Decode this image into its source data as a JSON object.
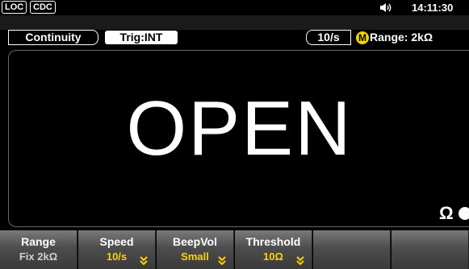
{
  "status": {
    "loc": "LOC",
    "cdc": "CDC",
    "time": "14:11:30"
  },
  "info": {
    "mode": "Continuity",
    "trigger": "Trig:INT",
    "rate": "10/s",
    "m_icon": "M",
    "range": "Range:  2kΩ"
  },
  "display": {
    "reading": "OPEN",
    "unit": "Ω"
  },
  "softkeys": [
    {
      "label": "Range",
      "value": "Fix 2kΩ"
    },
    {
      "label": "Speed",
      "value": "10/s"
    },
    {
      "label": "BeepVol",
      "value": "Small"
    },
    {
      "label": "Threshold",
      "value": "10Ω"
    },
    {
      "label": "",
      "value": ""
    },
    {
      "label": "",
      "value": ""
    }
  ],
  "colors": {
    "accent": "#ffd200",
    "m_badge": "#f2d400"
  },
  "icons": {
    "speaker": "speaker-icon",
    "beep": "beep-indicator-icon",
    "dropdown": "double-chevron-down-icon"
  }
}
